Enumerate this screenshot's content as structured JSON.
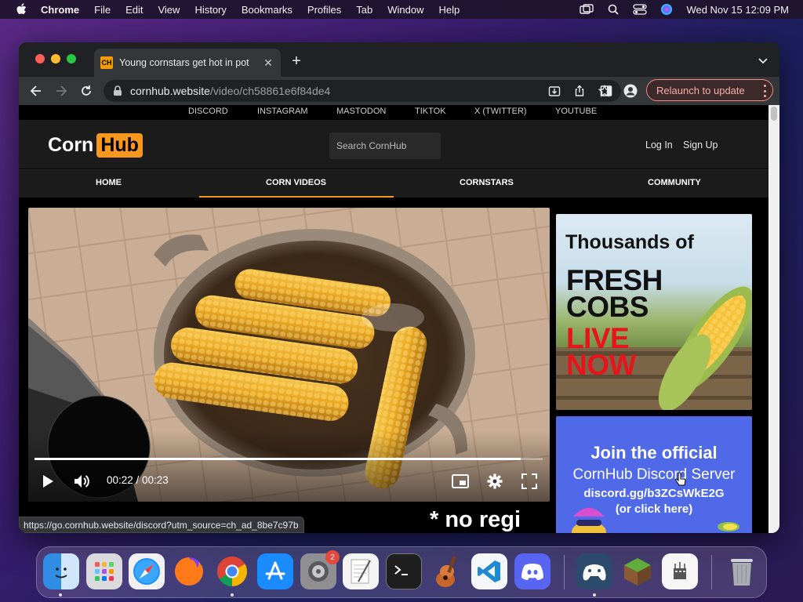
{
  "menubar": {
    "app": "Chrome",
    "items": [
      "File",
      "Edit",
      "View",
      "History",
      "Bookmarks",
      "Profiles",
      "Tab",
      "Window",
      "Help"
    ],
    "clock": "Wed Nov 15  12:09 PM"
  },
  "browser": {
    "tab_title": "Young cornstars get hot in pot",
    "favicon_text": "CH",
    "url_host": "cornhub.website",
    "url_path": "/video/ch58861e6f84de4",
    "relaunch_label": "Relaunch to update",
    "status_url": "https://go.cornhub.website/discord?utm_source=ch_ad_8be7c97b"
  },
  "site": {
    "social_links": [
      "DISCORD",
      "INSTAGRAM",
      "MASTODON",
      "TIKTOK",
      "X (TWITTER)",
      "YOUTUBE"
    ],
    "logo_left": "Corn",
    "logo_right": "Hub",
    "search_placeholder": "Search CornHub",
    "login": "Log In",
    "signup": "Sign Up",
    "nav": [
      "HOME",
      "CORN VIDEOS",
      "CORNSTARS",
      "COMMUNITY"
    ],
    "active_nav": "CORN VIDEOS"
  },
  "video": {
    "time": "00:22 / 00:23",
    "progress_fraction": 0.957
  },
  "ads": {
    "ad1": {
      "line1": "Thousands of",
      "line2": "FRESH",
      "line3": "COBS",
      "line4": "LIVE",
      "line5": "NOW"
    },
    "ad2": {
      "line1": "Join the official",
      "line2": "CornHub Discord Server",
      "line3": "discord.gg/b3ZCsWkE2G",
      "line4": "(or click here)"
    }
  },
  "below_text": "* no regi",
  "dock": {
    "settings_badge": "2"
  },
  "colors": {
    "accent": "#f7971c",
    "discord_blue": "#5069e8",
    "live_red": "#e8141c"
  }
}
